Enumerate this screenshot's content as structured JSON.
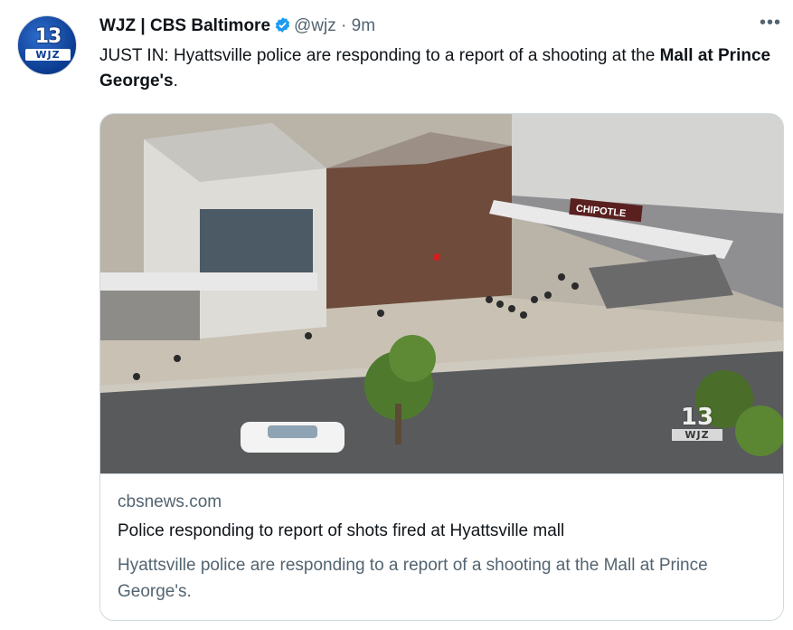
{
  "tweet": {
    "avatar_logo": {
      "number": "13",
      "callsign": "WJZ"
    },
    "display_name": "WJZ | CBS Baltimore",
    "verified_icon": "verified-badge-icon",
    "handle": "@wjz",
    "separator": "·",
    "time": "9m",
    "more_icon": "more-horizontal-icon",
    "more_label": "•••",
    "text_prefix": "JUST IN: Hyattsville police are responding to a report of a shooting at the ",
    "text_bold": "Mall at Prince George's",
    "text_suffix": "."
  },
  "card": {
    "image_watermark": {
      "number": "13",
      "callsign": "WJZ"
    },
    "image_sign_text": "CHIPOTLE",
    "domain": "cbsnews.com",
    "title": "Police responding to report of shots fired at Hyattsville mall",
    "description": "Hyattsville police are responding to a report of a shooting at the Mall at Prince George's."
  },
  "colors": {
    "verified": "#1d9bf0",
    "text_primary": "#0f1419",
    "text_secondary": "#536471",
    "border": "#cfd9de"
  }
}
